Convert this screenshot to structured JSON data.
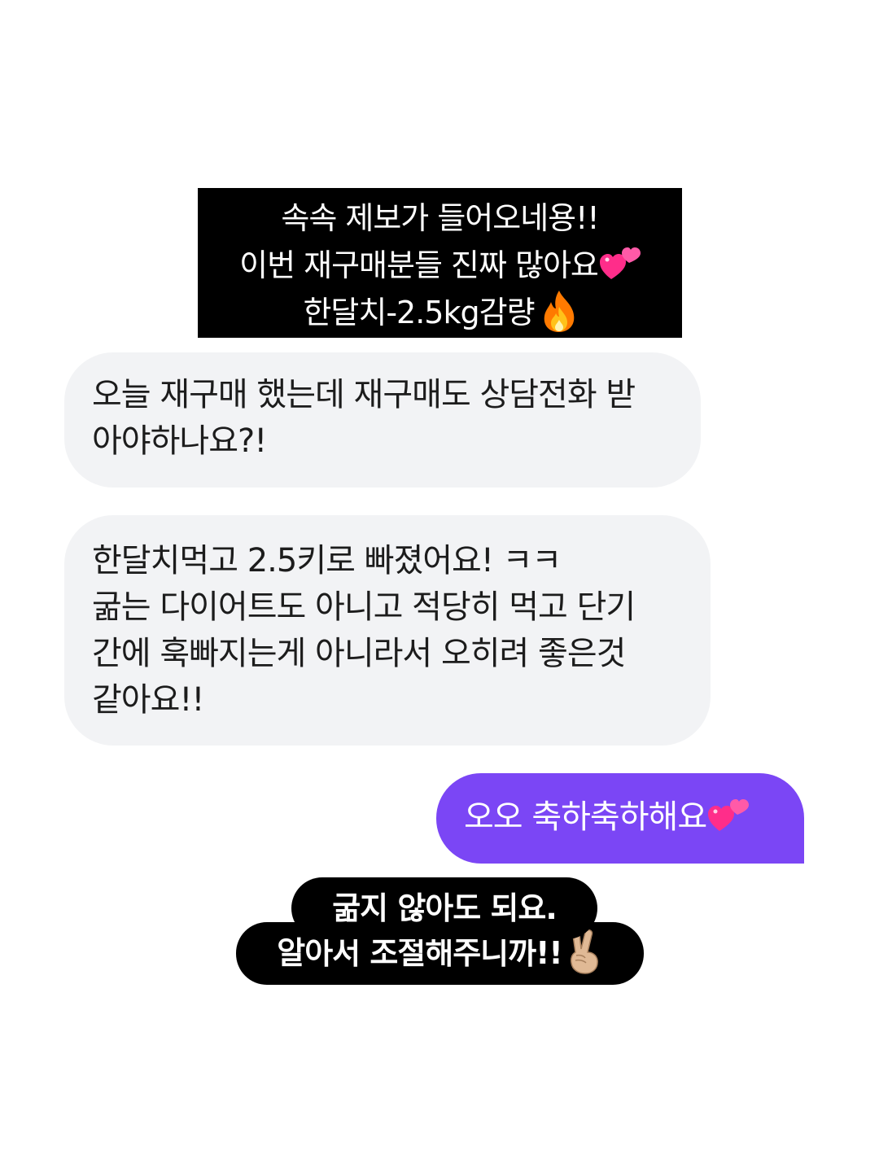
{
  "caption_top": {
    "line1": "속속 제보가 들어오네용!!",
    "line2": "이번 재구매분들 진짜 많아요",
    "line2_emoji": "two-hearts-icon",
    "line3": "한달치-2.5kg감량",
    "line3_emoji": "fire-icon"
  },
  "messages": {
    "received_1": {
      "line1": "오늘 재구매 했는데 재구매도 상담전화 받",
      "line2": "아야하나요?!"
    },
    "received_2": {
      "line1": "한달치먹고 2.5키로 빠졌어요! ㅋㅋ",
      "line2": "굶는 다이어트도 아니고  적당히 먹고 단기",
      "line3": "간에 훅빠지는게 아니라서 오히려 좋은것",
      "line4": "같아요!!"
    },
    "sent_1": {
      "text": "오오 축하축하해요",
      "emoji": "two-hearts-icon"
    }
  },
  "caption_bottom": {
    "line1": "굶지 않아도 되요.",
    "line2": "알아서 조절해주니까!!",
    "line2_emoji": "victory-hand-icon"
  },
  "colors": {
    "caption_bg": "#000000",
    "received_bubble": "#f2f3f5",
    "sent_bubble": "#7b46f5",
    "heart_pink": "#ff2d8a",
    "fire_orange": "#ff7a00"
  }
}
